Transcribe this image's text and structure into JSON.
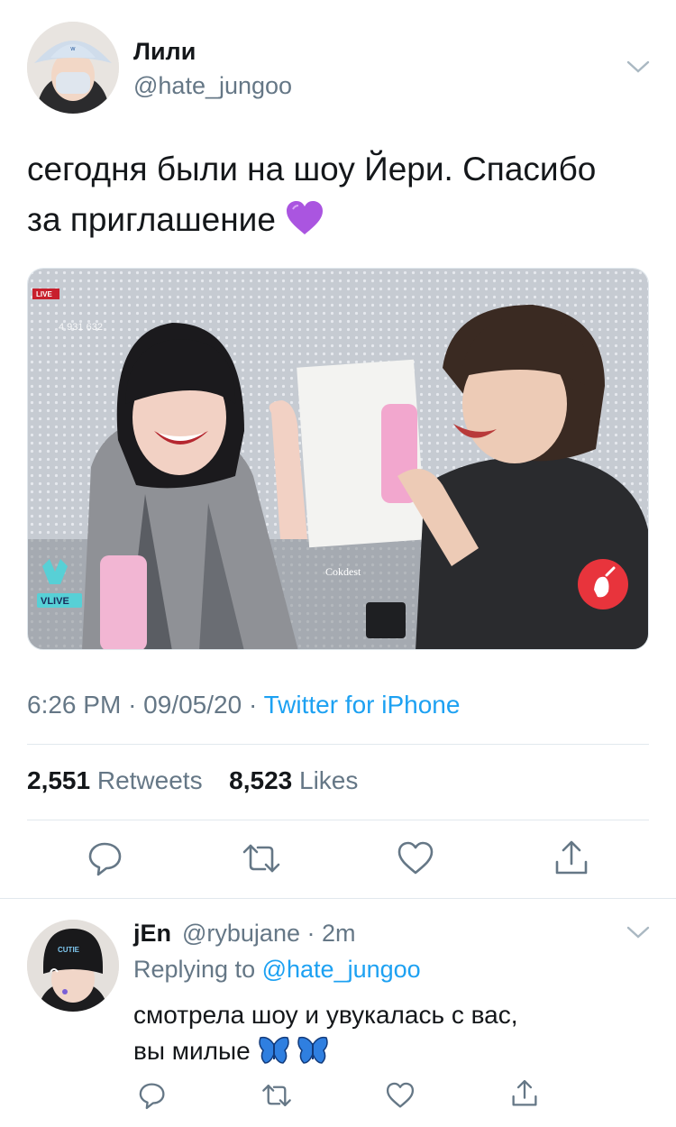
{
  "tweet": {
    "author_name": "Лили",
    "author_handle": "@hate_jungoo",
    "text_line1": "сегодня были на шоу Йери. Спасибо",
    "text_line2": "за приглашение",
    "emoji_icon": "purple-heart-icon",
    "media": {
      "live_badge": "LIVE",
      "viewer_count": "4 931 632",
      "vlive_label": "VLIVE",
      "watermark": "Cokdest"
    },
    "time": "6:26 PM",
    "dot": "·",
    "date": "09/05/20",
    "source": "Twitter for iPhone",
    "retweet_count": "2,551",
    "retweet_label": "Retweets",
    "like_count": "8,523",
    "like_label": "Likes",
    "actions": [
      "reply-icon",
      "retweet-icon",
      "like-icon",
      "share-icon"
    ]
  },
  "reply": {
    "author_name": "jEn",
    "author_handle": "@rybujane",
    "dot": "·",
    "time_ago": "2m",
    "replying_prefix": "Replying to",
    "replying_handle": "@hate_jungoo",
    "text_line1": "смотрела шоу и увукалась с вас,",
    "text_line2": "вы милые",
    "emoji_icons": [
      "butterfly-icon",
      "butterfly-icon"
    ],
    "beanie_text": "CUTIE",
    "actions": [
      "reply-icon",
      "retweet-icon",
      "like-icon",
      "share-icon"
    ]
  },
  "colors": {
    "text": "#14171a",
    "secondary": "#657786",
    "link": "#1da1f2",
    "divider": "#e1e8ed"
  }
}
